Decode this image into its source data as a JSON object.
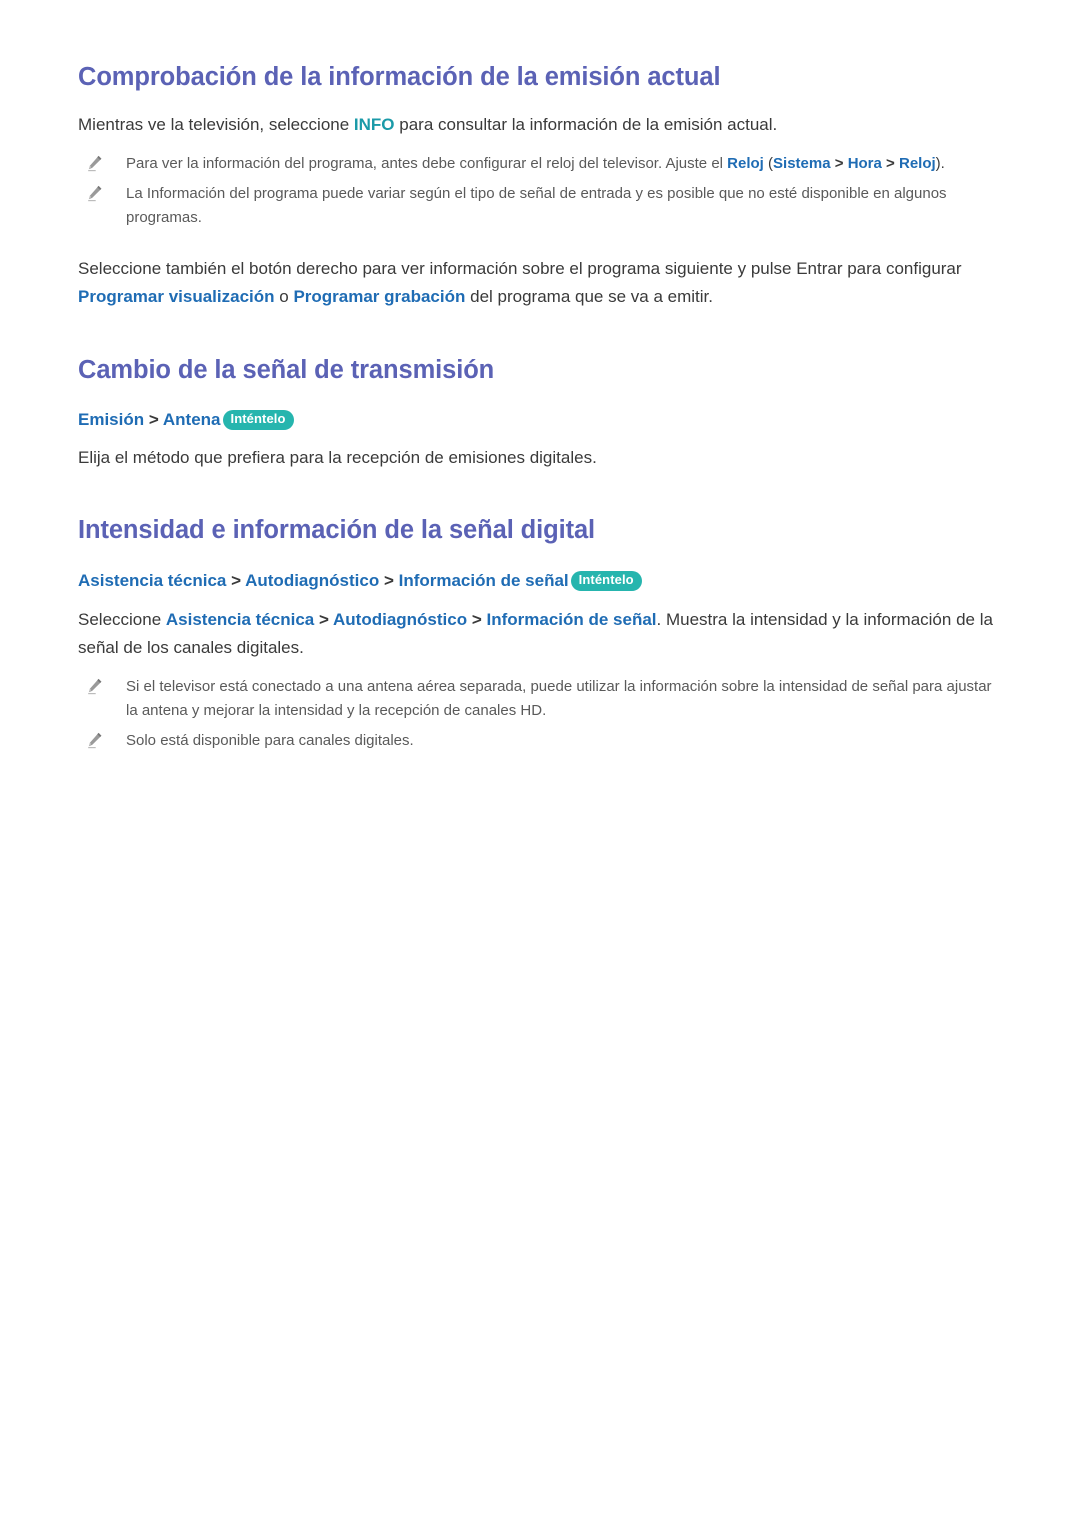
{
  "document": {
    "language": "es",
    "colors": {
      "heading": "#5b62b5",
      "link_blue": "#1f6cb4",
      "link_teal": "#1a9aa8",
      "body_text": "#3a3a3a",
      "note_text": "#5a5a5a",
      "badge_bg": "#26b5ae",
      "badge_text": "#ffffff",
      "page_bg": "#ffffff"
    }
  },
  "sections": [
    {
      "heading": "Comprobación de la información de la emisión actual",
      "intro": {
        "before": "Mientras ve la televisión, seleccione ",
        "keyword": "INFO",
        "after": " para consultar la información de la emisión actual."
      },
      "notes": [
        {
          "icon": "pencil-icon",
          "part1": "Para ver la información del programa, antes debe configurar el reloj del televisor. Ajuste el ",
          "link1": "Reloj",
          "paren_open": " (",
          "link2": "Sistema",
          "sep1": " > ",
          "link3": "Hora",
          "sep2": " > ",
          "link4": "Reloj",
          "paren_close": ")."
        },
        {
          "icon": "pencil-icon",
          "text": "La Información del programa puede variar según el tipo de señal de entrada y es posible que no esté disponible en algunos programas."
        }
      ],
      "outro": {
        "before": "Seleccione también el botón derecho para ver información sobre el programa siguiente y pulse Entrar para configurar ",
        "link1": "Programar visualización",
        "middle": " o ",
        "link2": "Programar grabación",
        "after": " del programa que se va a emitir."
      }
    },
    {
      "heading": "Cambio de la señal de transmisión",
      "menu_path": {
        "item1": "Emisión",
        "sep1": " > ",
        "item2": "Antena",
        "badge": "Inténtelo"
      },
      "body": "Elija el método que prefiera para la recepción de emisiones digitales."
    },
    {
      "heading": "Intensidad e información de la señal digital",
      "menu_path": {
        "item1": "Asistencia técnica",
        "sep1": " > ",
        "item2": "Autodiagnóstico",
        "sep2": " > ",
        "item3": "Información de señal",
        "badge": "Inténtelo"
      },
      "body": {
        "before": "Seleccione ",
        "link1": "Asistencia técnica",
        "sep1": " > ",
        "link2": "Autodiagnóstico",
        "sep2": " > ",
        "link3": "Información de señal",
        "after": ". Muestra la intensidad y la información de la señal de los canales digitales."
      },
      "notes": [
        {
          "icon": "pencil-icon",
          "text": "Si el televisor está conectado a una antena aérea separada, puede utilizar la información sobre la intensidad de señal para ajustar la antena y mejorar la intensidad y la recepción de canales HD."
        },
        {
          "icon": "pencil-icon",
          "text": "Solo está disponible para canales digitales."
        }
      ]
    }
  ]
}
